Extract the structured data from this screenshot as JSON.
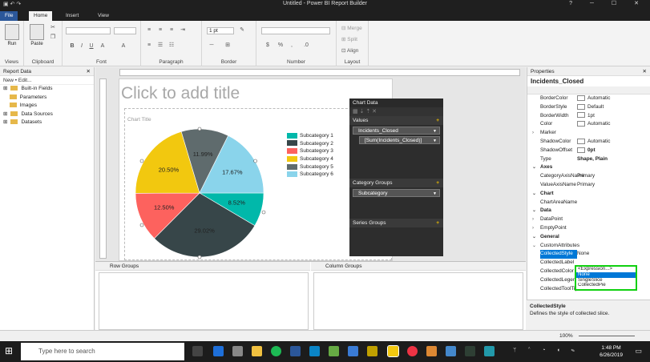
{
  "app": {
    "title": "Untitled - Power BI Report Builder"
  },
  "tabs": {
    "file": "File",
    "home": "Home",
    "insert": "Insert",
    "view": "View"
  },
  "ribbon": {
    "views": "Views",
    "run": "Run",
    "clipboard": "Clipboard",
    "paste": "Paste",
    "font": "Font",
    "paragraph": "Paragraph",
    "border": "Border",
    "border_width": "1 pt",
    "number": "Number",
    "layout": "Layout",
    "merge": "Merge",
    "split": "Split",
    "align": "Align"
  },
  "report_data": {
    "title": "Report Data",
    "toolbar": "New •  Edit...",
    "items": [
      "Built-in Fields",
      "Parameters",
      "Images",
      "Data Sources",
      "Datasets"
    ]
  },
  "canvas": {
    "placeholder": "Click to add title",
    "chart_title": "Chart Title"
  },
  "chart_data": {
    "type": "pie",
    "title": "Chart Title",
    "categories": [
      "Subcategory 1",
      "Subcategory 2",
      "Subcategory 3",
      "Subcategory 4",
      "Subcategory 5",
      "Subcategory 6"
    ],
    "values": [
      8.52,
      29.02,
      12.5,
      20.5,
      11.99,
      17.67
    ],
    "labels": [
      "8.52%",
      "29.02%",
      "12.50%",
      "20.50%",
      "11.99%",
      "17.67%"
    ],
    "colors": [
      "#01b8aa",
      "#374649",
      "#fd625e",
      "#f2c80f",
      "#5f6b6d",
      "#8ad4eb"
    ],
    "legend_position": "right"
  },
  "chart_panel": {
    "title": "Chart Data",
    "values": "Values",
    "value_series": "Incidents_Closed",
    "value_expr": "[Sum(Incidents_Closed)]",
    "category_groups": "Category Groups",
    "category_field": "Subcategory",
    "series_groups": "Series Groups"
  },
  "groups": {
    "row": "Row Groups",
    "column": "Column Groups"
  },
  "properties": {
    "title": "Properties",
    "object": "Incidents_Closed",
    "rows": [
      {
        "k": "BorderColor",
        "v": "Automatic",
        "sw": true
      },
      {
        "k": "BorderStyle",
        "v": "Default",
        "sw": true
      },
      {
        "k": "BorderWidth",
        "v": "1pt",
        "sw": true
      },
      {
        "k": "Color",
        "v": "Automatic",
        "sw": true
      },
      {
        "k": "Marker",
        "v": "",
        "tw": "›"
      },
      {
        "k": "ShadowColor",
        "v": "Automatic",
        "sw": true
      },
      {
        "k": "ShadowOffset",
        "v": "0pt",
        "sw": true,
        "bold": true
      },
      {
        "k": "Type",
        "v": "Shape, Plain",
        "bold": true
      },
      {
        "k": "Axes",
        "v": "",
        "cat": true,
        "tw": "⌄"
      },
      {
        "k": "CategoryAxisName",
        "v": "Primary"
      },
      {
        "k": "ValueAxisName",
        "v": "Primary"
      },
      {
        "k": "Chart",
        "v": "",
        "cat": true,
        "tw": "⌄"
      },
      {
        "k": "ChartAreaName",
        "v": ""
      },
      {
        "k": "Data",
        "v": "",
        "cat": true,
        "tw": "⌄"
      },
      {
        "k": "DataPoint",
        "v": "",
        "tw": "›"
      },
      {
        "k": "EmptyPoint",
        "v": "",
        "tw": "›"
      },
      {
        "k": "General",
        "v": "",
        "cat": true,
        "tw": "⌄"
      },
      {
        "k": "CustomAttributes",
        "v": "",
        "tw": "⌄"
      },
      {
        "k": "CollectedStyle",
        "v": "None",
        "sel": true
      },
      {
        "k": "CollectedLabel",
        "v": ""
      },
      {
        "k": "CollectedColor",
        "v": ""
      },
      {
        "k": "CollectedLegend",
        "v": ""
      },
      {
        "k": "CollectedToolTip",
        "v": ""
      }
    ],
    "dropdown": [
      "<Expression...>",
      "None",
      "SingleSlice",
      "CollectedPie"
    ],
    "desc_title": "CollectedStyle",
    "desc_text": "Defines the style of collected slice."
  },
  "status": {
    "zoom": "100%"
  },
  "taskbar": {
    "search": "Type here to search",
    "time": "1:48 PM",
    "date": "6/26/2019"
  }
}
